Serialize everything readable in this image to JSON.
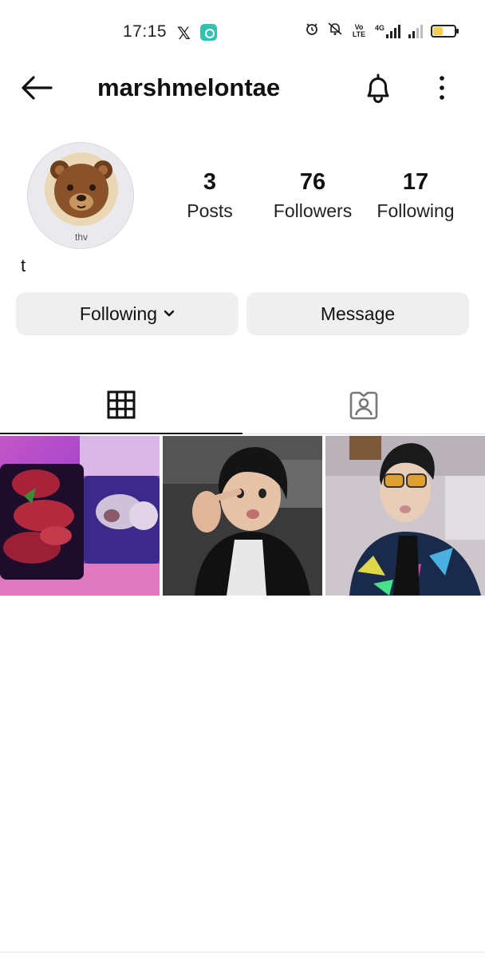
{
  "status_bar": {
    "time": "17:15",
    "x_icon": "x-logo-icon",
    "app_icon": "chat-app-icon",
    "alarm_icon": "alarm-icon",
    "mute_icon": "bell-muted-icon",
    "volte_text": "Vo LTE",
    "network_text": "4G",
    "battery_level_percent": 45,
    "battery_color": "#f2d04a"
  },
  "header": {
    "username": "marshmelontae",
    "back_icon": "arrow-left-icon",
    "notification_icon": "bell-icon",
    "more_icon": "more-vertical-icon"
  },
  "profile": {
    "avatar_label": "thv",
    "avatar_icon": "bear-emoji-icon",
    "stats": {
      "posts": {
        "count": "3",
        "label": "Posts"
      },
      "followers": {
        "count": "76",
        "label": "Followers"
      },
      "following": {
        "count": "17",
        "label": "Following"
      }
    },
    "bio": "t"
  },
  "actions": {
    "following_label": "Following",
    "message_label": "Message"
  },
  "tabs": {
    "grid_icon": "grid-icon",
    "tagged_icon": "tagged-person-icon",
    "active": "grid"
  },
  "posts": [
    {
      "subject": "food-photo",
      "accent": "#b03a8a"
    },
    {
      "subject": "person-selfie",
      "accent": "#2a2a2a"
    },
    {
      "subject": "person-sunglasses",
      "accent": "#c9c2c8"
    }
  ]
}
